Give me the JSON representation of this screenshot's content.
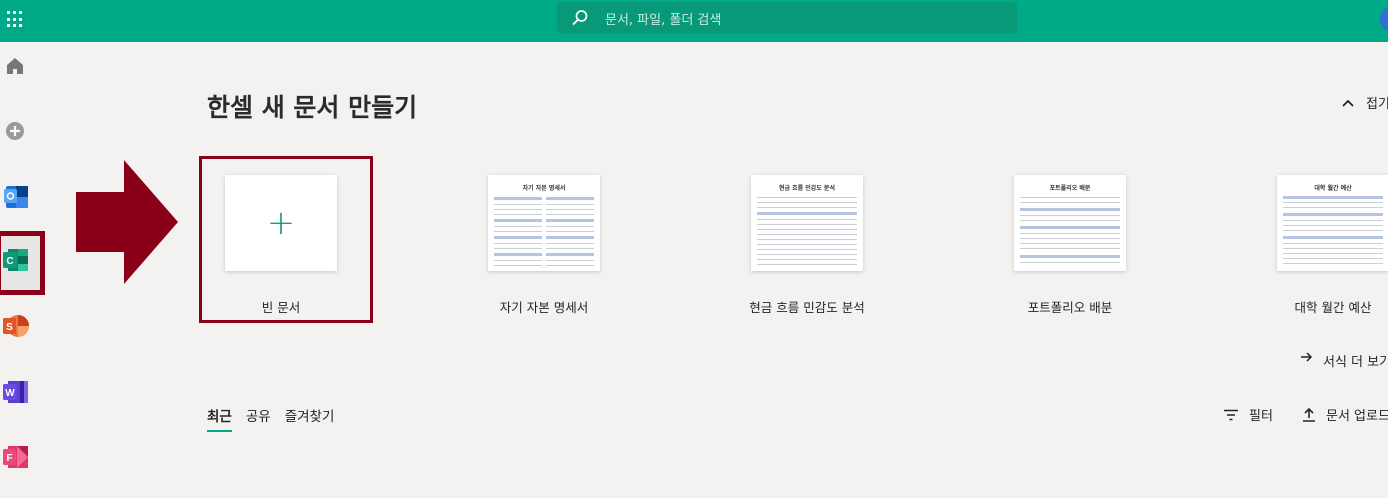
{
  "header": {
    "search_placeholder": "문서, 파일, 폴더 검색",
    "brand_color": "#00a988"
  },
  "rail": {
    "items": [
      {
        "name": "home",
        "icon": "home-icon"
      },
      {
        "name": "create",
        "icon": "plus-circle-icon"
      },
      {
        "name": "calendar-app",
        "icon": "calendar-app-icon"
      },
      {
        "name": "hancell",
        "icon": "hancell-app-icon",
        "letter": "C"
      },
      {
        "name": "hanshow",
        "icon": "hanshow-app-icon",
        "letter": "S"
      },
      {
        "name": "hanword",
        "icon": "hanword-app-icon",
        "letter": "W"
      },
      {
        "name": "forms",
        "icon": "forms-app-icon",
        "letter": "F"
      }
    ]
  },
  "main": {
    "title": "한셀 새 문서 만들기",
    "collapse_label": "접기",
    "templates": [
      {
        "label": "빈 문서"
      },
      {
        "label": "자기 자본 명세서",
        "thumb_title": "자기 자본 명세서"
      },
      {
        "label": "현금 흐름 민감도 분석",
        "thumb_title": "현금 흐름 민감도 분석"
      },
      {
        "label": "포트폴리오 배분",
        "thumb_title": "포트폴리오 배분"
      },
      {
        "label": "대학 월간 예산",
        "thumb_title": "대학 월간 예산"
      }
    ],
    "more_formats_label": "서식 더 보기"
  },
  "files": {
    "tabs": [
      "최근",
      "공유",
      "즐겨찾기"
    ],
    "active_tab": "최근",
    "filter_label": "필터",
    "upload_label": "문서 업로드"
  },
  "annotation": {
    "highlight_color": "#8b0019"
  }
}
